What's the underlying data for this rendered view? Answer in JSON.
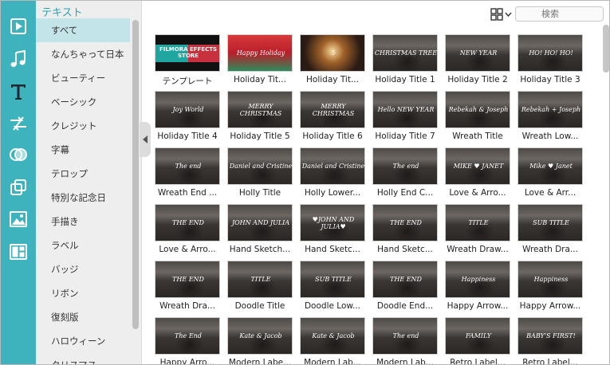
{
  "rail": {
    "icons": [
      "media-icon",
      "music-icon",
      "text-icon",
      "transition-icon",
      "filter-icon",
      "overlay-icon",
      "elements-icon",
      "split-screen-icon"
    ]
  },
  "category_panel": {
    "title": "テキスト",
    "items": [
      {
        "label": "すべて",
        "active": true
      },
      {
        "label": "なんちゃって日本",
        "active": false
      },
      {
        "label": "ビューティー",
        "active": false
      },
      {
        "label": "ベーシック",
        "active": false
      },
      {
        "label": "クレジット",
        "active": false
      },
      {
        "label": "字幕",
        "active": false
      },
      {
        "label": "テロップ",
        "active": false
      },
      {
        "label": "特別な記念日",
        "active": false
      },
      {
        "label": "手描き",
        "active": false
      },
      {
        "label": "ラベル",
        "active": false
      },
      {
        "label": "バッジ",
        "active": false
      },
      {
        "label": "リボン",
        "active": false
      },
      {
        "label": "復刻版",
        "active": false
      },
      {
        "label": "ハロウィーン",
        "active": false
      },
      {
        "label": "クリスマス",
        "active": false
      }
    ]
  },
  "toolbar": {
    "search_placeholder": "検索"
  },
  "tiles": [
    {
      "label": "テンプレート",
      "style": "t-template",
      "overlay": "FILMORA EFFECTS STORE"
    },
    {
      "label": "Holiday Tit...",
      "style": "t-holiday1",
      "overlay": "Happy Holiday"
    },
    {
      "label": "Holiday Tit...",
      "style": "t-holiday2",
      "overlay": "5"
    },
    {
      "label": "Holiday Title 1",
      "style": "",
      "overlay": "CHRISTMAS TREE"
    },
    {
      "label": "Holiday Title 2",
      "style": "",
      "overlay": "NEW YEAR"
    },
    {
      "label": "Holiday Title 3",
      "style": "",
      "overlay": "HO! HO! HO!"
    },
    {
      "label": "Holiday Title 4",
      "style": "",
      "overlay": "Joy World"
    },
    {
      "label": "Holiday Title 5",
      "style": "",
      "overlay": "MERRY CHRISTMAS"
    },
    {
      "label": "Holiday Title 6",
      "style": "",
      "overlay": "MERRY CHRISTMAS"
    },
    {
      "label": "Holiday Title 7",
      "style": "",
      "overlay": "Hello NEW YEAR"
    },
    {
      "label": "Wreath Title",
      "style": "",
      "overlay": "Rebekah & Joseph"
    },
    {
      "label": "Wreath Low...",
      "style": "",
      "overlay": "Rebekah + Joseph"
    },
    {
      "label": "Wreath End ...",
      "style": "",
      "overlay": "The end"
    },
    {
      "label": "Holly Title",
      "style": "",
      "overlay": "Daniel and Cristine"
    },
    {
      "label": "Holly Lower...",
      "style": "",
      "overlay": "Daniel and Cristine"
    },
    {
      "label": "Holly End C...",
      "style": "",
      "overlay": "The end"
    },
    {
      "label": "Love & Arro...",
      "style": "",
      "overlay": "MIKE ♥ JANET"
    },
    {
      "label": "Love & Arr...",
      "style": "",
      "overlay": "Mike ♥ Janet"
    },
    {
      "label": "Love & Arro...",
      "style": "",
      "overlay": "THE END"
    },
    {
      "label": "Hand Sketch...",
      "style": "",
      "overlay": "JOHN AND JULIA"
    },
    {
      "label": "Hand Sketc...",
      "style": "",
      "overlay": "♥JOHN AND JULIA♥"
    },
    {
      "label": "Hand Sketc...",
      "style": "",
      "overlay": "THE END"
    },
    {
      "label": "Wreath Draw...",
      "style": "",
      "overlay": "TITLE"
    },
    {
      "label": "Wreath Dra...",
      "style": "",
      "overlay": "SUB TITLE"
    },
    {
      "label": "Wreath Dra...",
      "style": "",
      "overlay": "THE END"
    },
    {
      "label": "Doodle Title",
      "style": "",
      "overlay": "TITLE"
    },
    {
      "label": "Doodle Low...",
      "style": "",
      "overlay": "SUB TITLE"
    },
    {
      "label": "Doodle End...",
      "style": "",
      "overlay": "THE END"
    },
    {
      "label": "Happy Arrow...",
      "style": "",
      "overlay": "Happiness"
    },
    {
      "label": "Happy Arrow...",
      "style": "",
      "overlay": "Happiness"
    },
    {
      "label": "Happy Arro...",
      "style": "",
      "overlay": "The End"
    },
    {
      "label": "Modern Labe...",
      "style": "",
      "overlay": "Kate & Jacob"
    },
    {
      "label": "Modern Lab...",
      "style": "",
      "overlay": "Kate & Jacob"
    },
    {
      "label": "Modern Lab...",
      "style": "",
      "overlay": "The end"
    },
    {
      "label": "Retro Label...",
      "style": "",
      "overlay": "FAMILY"
    },
    {
      "label": "Retro Label...",
      "style": "",
      "overlay": "BABY'S FIRST!"
    }
  ]
}
